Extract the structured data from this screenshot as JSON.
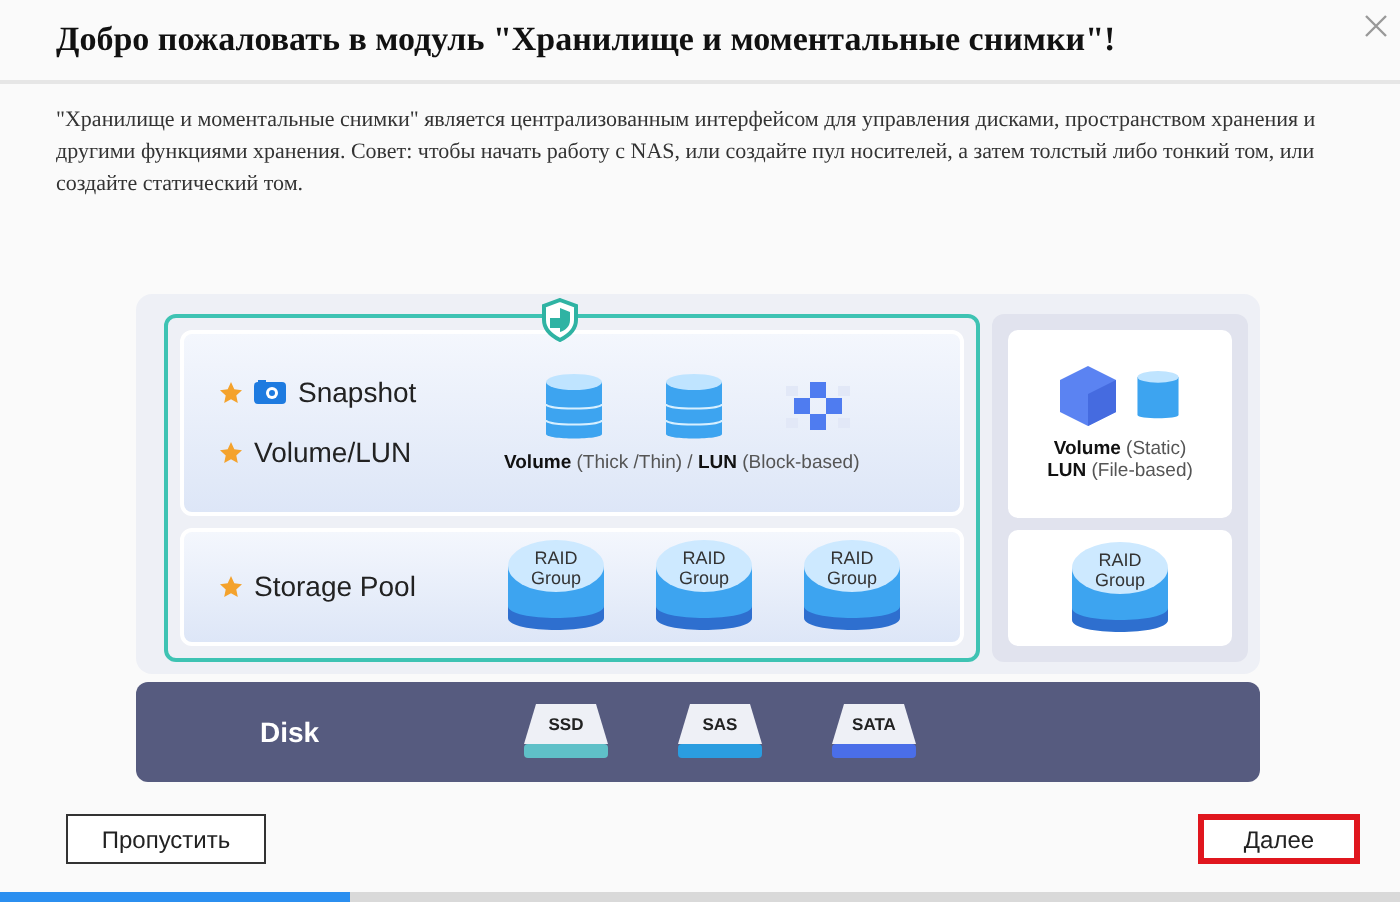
{
  "dialog": {
    "title": "Добро пожаловать в модуль \"Хранилище и моментальные снимки\"!",
    "description": "\"Хранилище и моментальные снимки\" является централизованным интерфейсом для управления дисками, пространством хранения и другими функциями хранения. Совет: чтобы начать работу с NAS, или создайте пул носителей, а затем толстый либо тонкий том, или создайте статический том.",
    "diagram": {
      "upper_layers": [
        {
          "label": "Snapshot",
          "kind": "snapshot"
        },
        {
          "label": "Volume/LUN",
          "kind": "plain"
        }
      ],
      "volume_caption": "**Volume** (Thick /Thin)  / **LUN** (Block-based)",
      "pool": {
        "label": "Storage Pool",
        "raid_groups": [
          "RAID Group",
          "RAID Group",
          "RAID Group"
        ]
      },
      "static": {
        "captions": [
          "**Volume** (Static)",
          "**LUN** (File-based)"
        ],
        "raid_group": "RAID Group"
      },
      "disk": {
        "label": "Disk",
        "types": [
          {
            "label": "SSD",
            "color": "#5fc0c8"
          },
          {
            "label": "SAS",
            "color": "#2a9de0"
          },
          {
            "label": "SATA",
            "color": "#4a6ee8"
          }
        ]
      }
    },
    "buttons": [
      {
        "label": "Пропустить",
        "highlighted": false
      },
      {
        "label": "Далее",
        "highlighted": true
      }
    ],
    "progress": {
      "level": 0.25
    }
  }
}
